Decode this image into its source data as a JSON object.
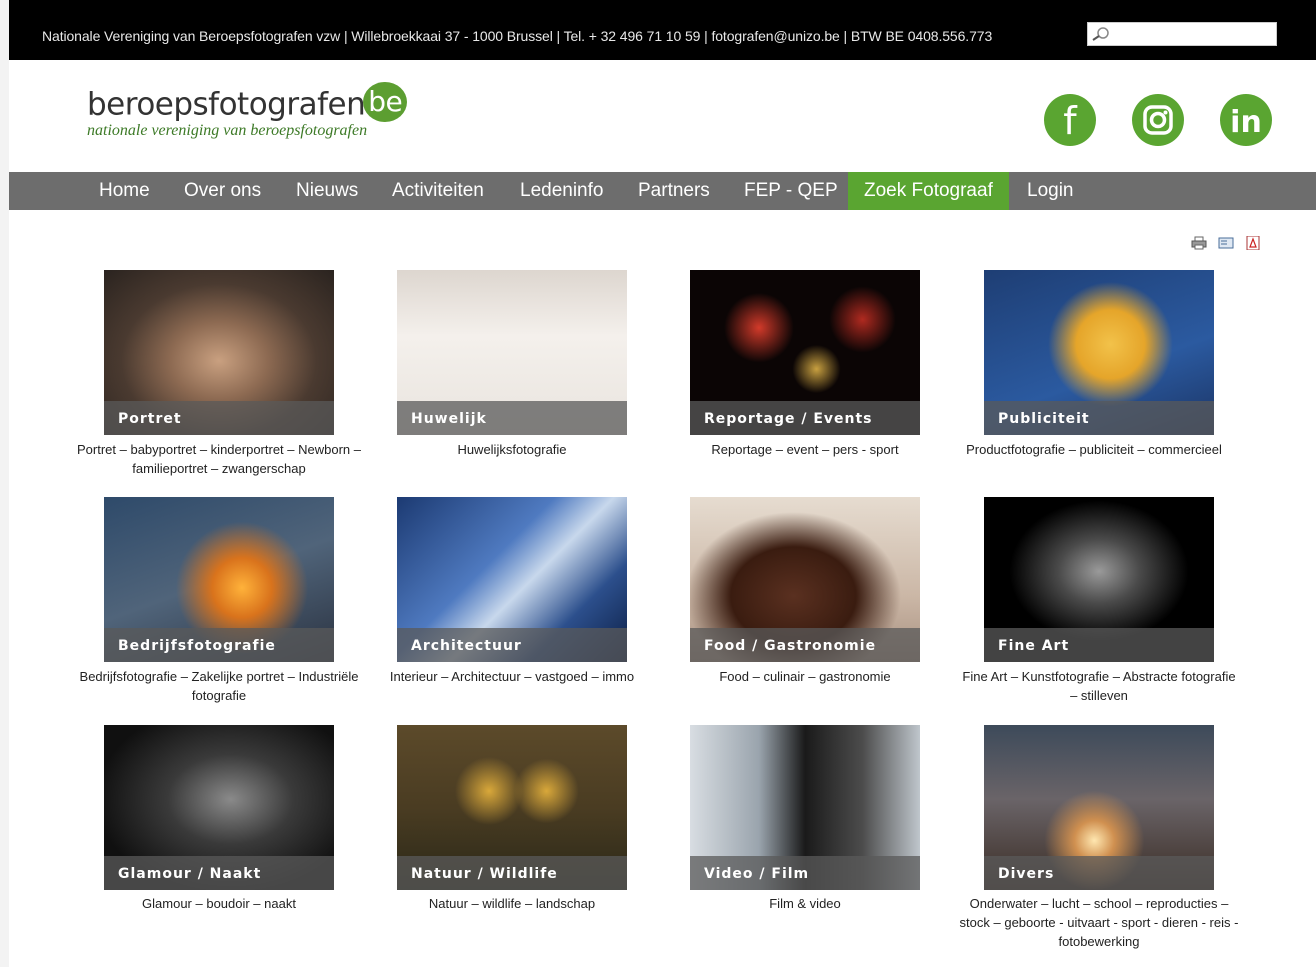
{
  "topbar": {
    "info": "Nationale Vereniging van Beroepsfotografen vzw | Willebroekkaai 37 - 1000 Brussel | Tel. + 32 496 71 10 59 | fotografen@unizo.be | BTW BE 0408.556.773",
    "search_value": ""
  },
  "logo": {
    "main": "beroepsfotografen",
    "suffix": "be",
    "tagline": "nationale vereniging van beroepsfotografen"
  },
  "social": {
    "facebook": "f",
    "instagram": "instagram-icon",
    "linkedin": "in"
  },
  "nav": [
    {
      "label": "Home"
    },
    {
      "label": "Over ons"
    },
    {
      "label": "Nieuws"
    },
    {
      "label": "Activiteiten"
    },
    {
      "label": "Ledeninfo"
    },
    {
      "label": "Partners"
    },
    {
      "label": "FEP - QEP"
    },
    {
      "label": "Zoek Fotograaf",
      "active": true
    },
    {
      "label": "Login"
    }
  ],
  "tools": [
    "print-icon",
    "email-icon",
    "pdf-icon"
  ],
  "categories": [
    {
      "title": "Portret",
      "desc": "Portret – babyportret – kinderportret – Newborn – familieportret – zwangerschap"
    },
    {
      "title": "Huwelijk",
      "desc": "Huwelijksfotografie"
    },
    {
      "title": "Reportage / Events",
      "desc": "Reportage – event – pers - sport"
    },
    {
      "title": "Publiciteit",
      "desc": "Productfotografie – publiciteit – commercieel"
    },
    {
      "title": "Bedrijfsfotografie",
      "desc": "Bedrijfsfotografie – Zakelijke portret – Industriële fotografie"
    },
    {
      "title": "Architectuur",
      "desc": "Interieur – Architectuur – vastgoed – immo"
    },
    {
      "title": "Food / Gastronomie",
      "desc": "Food – culinair – gastronomie"
    },
    {
      "title": "Fine Art",
      "desc": "Fine Art – Kunstfotografie – Abstracte fotografie – stilleven"
    },
    {
      "title": "Glamour / Naakt",
      "desc": "Glamour – boudoir – naakt"
    },
    {
      "title": "Natuur / Wildlife",
      "desc": "Natuur – wildlife – landschap"
    },
    {
      "title": "Video / Film",
      "desc": "Film & video"
    },
    {
      "title": "Divers",
      "desc": "Onderwater – lucht – school – reproducties – stock – geboorte - uitvaart - sport - dieren - reis - fotobewerking"
    }
  ]
}
